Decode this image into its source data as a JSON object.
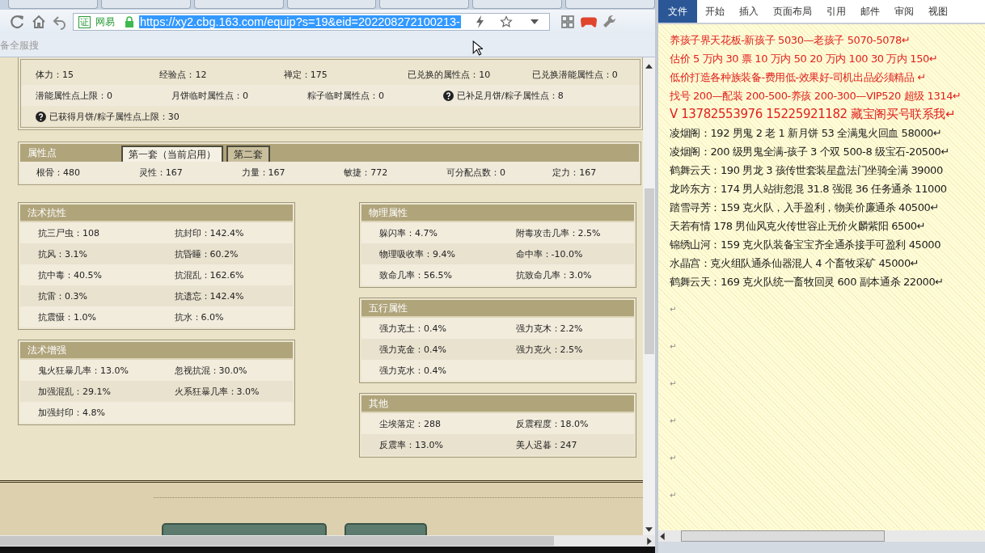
{
  "browser": {
    "address": {
      "badge": "证",
      "site": "网易",
      "url": "https://xy2.cbg.163.com/equip?s=19&eid=202208272100213-"
    },
    "bookmark": "备全服搜"
  },
  "top_stats": [
    [
      {
        "text": "体力：15",
        "help": false
      },
      {
        "text": "经验点：12",
        "help": false
      },
      {
        "text": "禅定：175",
        "help": false
      },
      {
        "text": "已兑换的属性点：10",
        "help": false
      },
      {
        "text": "已兑换潜能属性点：0",
        "help": false
      }
    ],
    [
      {
        "text": "潜能属性点上限：0",
        "help": false
      },
      {
        "text": "月饼临时属性点：0",
        "help": false
      },
      {
        "text": "粽子临时属性点：0",
        "help": false
      },
      {
        "text": "已补足月饼/粽子属性点：8",
        "help": true
      }
    ],
    [
      {
        "text": "已获得月饼/粽子属性点上限：30",
        "help": true
      }
    ]
  ],
  "attr_panel": {
    "title": "属性点",
    "tabs": [
      {
        "label": "第一套（当前启用）",
        "selected": true
      },
      {
        "label": "第二套",
        "selected": false
      }
    ],
    "stats": [
      "根骨：480",
      "灵性：167",
      "力量：167",
      "敏捷：772",
      "可分配点数：0",
      "定力：167"
    ]
  },
  "left_panels": [
    {
      "title": "法术抗性",
      "rows": [
        [
          "抗三尸虫：108",
          "抗封印：142.4%"
        ],
        [
          "抗风：3.1%",
          "抗昏睡：60.2%"
        ],
        [
          "抗中毒：40.5%",
          "抗混乱：162.6%"
        ],
        [
          "抗雷：0.3%",
          "抗遗忘：142.4%"
        ],
        [
          "抗震慑：1.0%",
          "抗水：6.0%"
        ]
      ]
    },
    {
      "title": "法术增强",
      "rows": [
        [
          "鬼火狂暴几率：13.0%",
          "忽视抗混：30.0%"
        ],
        [
          "加强混乱：29.1%",
          "火系狂暴几率：3.0%"
        ],
        [
          "加强封印：4.8%"
        ]
      ]
    }
  ],
  "right_panels": [
    {
      "title": "物理属性",
      "rows": [
        [
          "躲闪率：4.7%",
          "附毒攻击几率：2.5%"
        ],
        [
          "物理吸收率：9.4%",
          "命中率：-10.0%"
        ],
        [
          "致命几率：56.5%",
          "抗致命几率：3.0%"
        ]
      ]
    },
    {
      "title": "五行属性",
      "rows": [
        [
          "强力克土：0.4%",
          "强力克木：2.2%"
        ],
        [
          "强力克金：0.4%",
          "强力克火：2.5%"
        ],
        [
          "强力克水：0.4%"
        ]
      ]
    },
    {
      "title": "其他",
      "rows": [
        [
          "尘埃落定：288",
          "反震程度：18.0%"
        ],
        [
          "反震率：13.0%",
          "美人迟暮：247"
        ]
      ]
    }
  ],
  "word": {
    "tabs": [
      {
        "label": "文件",
        "selected": true
      },
      {
        "label": "开始",
        "selected": false
      },
      {
        "label": "插入",
        "selected": false
      },
      {
        "label": "页面布局",
        "selected": false
      },
      {
        "label": "引用",
        "selected": false
      },
      {
        "label": "邮件",
        "selected": false
      },
      {
        "label": "审阅",
        "selected": false
      },
      {
        "label": "视图",
        "selected": false
      }
    ],
    "paragraphs": [
      {
        "text": "养孩子界天花板-新孩子 5030—老孩子 5070-5078↵",
        "color": "#e0201c"
      },
      {
        "text": "估价 5 万内 30 票  10 万内 50  20 万内 100  30 万内 150↵",
        "color": "#e0201c"
      },
      {
        "text": "低价打造各种族装备-费用低-效果好-司机出品必须精品  ↵",
        "color": "#e0201c"
      },
      {
        "text": "找号 200—配装 200-500-养孩 200-300—VIP520 超级 1314↵",
        "color": "#e0201c"
      },
      {
        "text": "V 13782553976   15225921182  藏宝阁买号联系我↵",
        "color": "#e0201c",
        "large": true
      },
      {
        "text": "凌烟阁：192 男鬼 2 老 1 新月饼 53 全满鬼火回血 58000↵",
        "color": "#1a1a1a"
      },
      {
        "text": "凌烟阁：200 级男鬼全满-孩子 3 个双 500-8 级宝石-20500↵",
        "color": "#1a1a1a"
      },
      {
        "text": "鹤舞云天：190 男龙 3 孩传世套装星盘法门坐骑全满 39000",
        "color": "#1a1a1a"
      },
      {
        "text": "龙吟东方：174 男人站街忽混 31.8 强混 36 任务通杀 11000",
        "color": "#1a1a1a"
      },
      {
        "text": "踏雪寻芳：159 克火队，入手盈利，物美价廉通杀 40500↵",
        "color": "#1a1a1a"
      },
      {
        "text": "天若有情 178 男仙风克火传世容止无价火麟紫阳 6500↵",
        "color": "#1a1a1a"
      },
      {
        "text": "锦绣山河：159 克火队装备宝宝齐全通杀接手可盈利 45000",
        "color": "#1a1a1a"
      },
      {
        "text": "水晶宫：克火组队通杀仙器混人 4 个畜牧采矿 45000↵",
        "color": "#1a1a1a"
      },
      {
        "text": "鹤舞云天：169 克火队统一畜牧回灵 600 副本通杀 22000↵",
        "color": "#1a1a1a"
      }
    ],
    "empty_marks": [
      "↵",
      "↵",
      "↵",
      "↵",
      "↵",
      "↵"
    ]
  }
}
